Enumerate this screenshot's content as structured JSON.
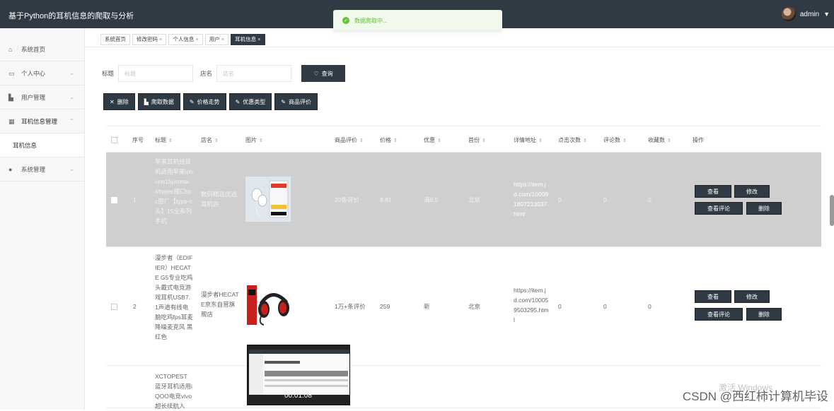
{
  "app": {
    "title": "基于Python的耳机信息的爬取与分析",
    "user": "admin"
  },
  "toast": {
    "message": "数据爬取中..."
  },
  "sidebar": {
    "items": [
      {
        "label": "系统首页",
        "icon": "home-icon"
      },
      {
        "label": "个人中心",
        "icon": "card-icon"
      },
      {
        "label": "用户管理",
        "icon": "bar-chart-icon"
      },
      {
        "label": "耳机信息管理",
        "icon": "grid-icon"
      },
      {
        "label": "耳机信息",
        "icon": ""
      },
      {
        "label": "系统管理",
        "icon": "person-icon"
      }
    ]
  },
  "tabs": [
    {
      "label": "系统首页",
      "closable": false
    },
    {
      "label": "修改密码",
      "closable": true
    },
    {
      "label": "个人信息",
      "closable": true
    },
    {
      "label": "用户",
      "closable": true
    },
    {
      "label": "耳机信息",
      "closable": true
    }
  ],
  "search": {
    "title_label": "标题",
    "title_placeholder": "标题",
    "shop_label": "店名",
    "shop_placeholder": "店名",
    "query_label": "查询"
  },
  "toolbar": {
    "delete": "删除",
    "crawl": "爬取数据",
    "price_trend": "价格走势",
    "discount_type": "优惠类型",
    "review": "商品评价"
  },
  "table": {
    "headers": [
      "序号",
      "标题",
      "店名",
      "图片",
      "商品评价",
      "价格",
      "优惠",
      "首份",
      "详情地址",
      "点击次数",
      "评论数",
      "收藏数",
      "操作"
    ],
    "rows": [
      {
        "index": "1",
        "title": "苹果耳机线耳机适用苹果iphone15promax/typec接口tpc原厂【type-c头】15全系列手机",
        "shop": "数码精选优选耳机店",
        "review": "20条评价",
        "price": "8.81",
        "discount": "满6.5",
        "province": "北京",
        "url": "https://item.jd.com/100091807213037.html",
        "clicks": "0",
        "comments": "0",
        "favorites": "0"
      },
      {
        "index": "2",
        "title": "漫步者（EDIFIER）HECATE G5专业吃鸡头戴式电竞游戏耳机USB7.1声道有线电脑吃鸡fps耳麦 降噪麦克风 黑红色",
        "shop": "漫步者HECATE京东自营旗舰店",
        "review": "1万+条评价",
        "price": "259",
        "discount": "新",
        "province": "北京",
        "url": "https://item.jd.com/100059503295.html",
        "clicks": "0",
        "comments": "0",
        "favorites": "0"
      },
      {
        "title": "XCTOPEST蓝牙耳机适用iQOO电竞vivo超长续航入"
      }
    ],
    "actions": {
      "view": "查看",
      "edit": "修改",
      "view_reviews": "查看评论",
      "delete": "删除"
    }
  },
  "video": {
    "time": "00:01:08"
  },
  "overlay": {
    "windows": "激活 Windows",
    "watermark": "CSDN @西红柿计算机毕设"
  }
}
